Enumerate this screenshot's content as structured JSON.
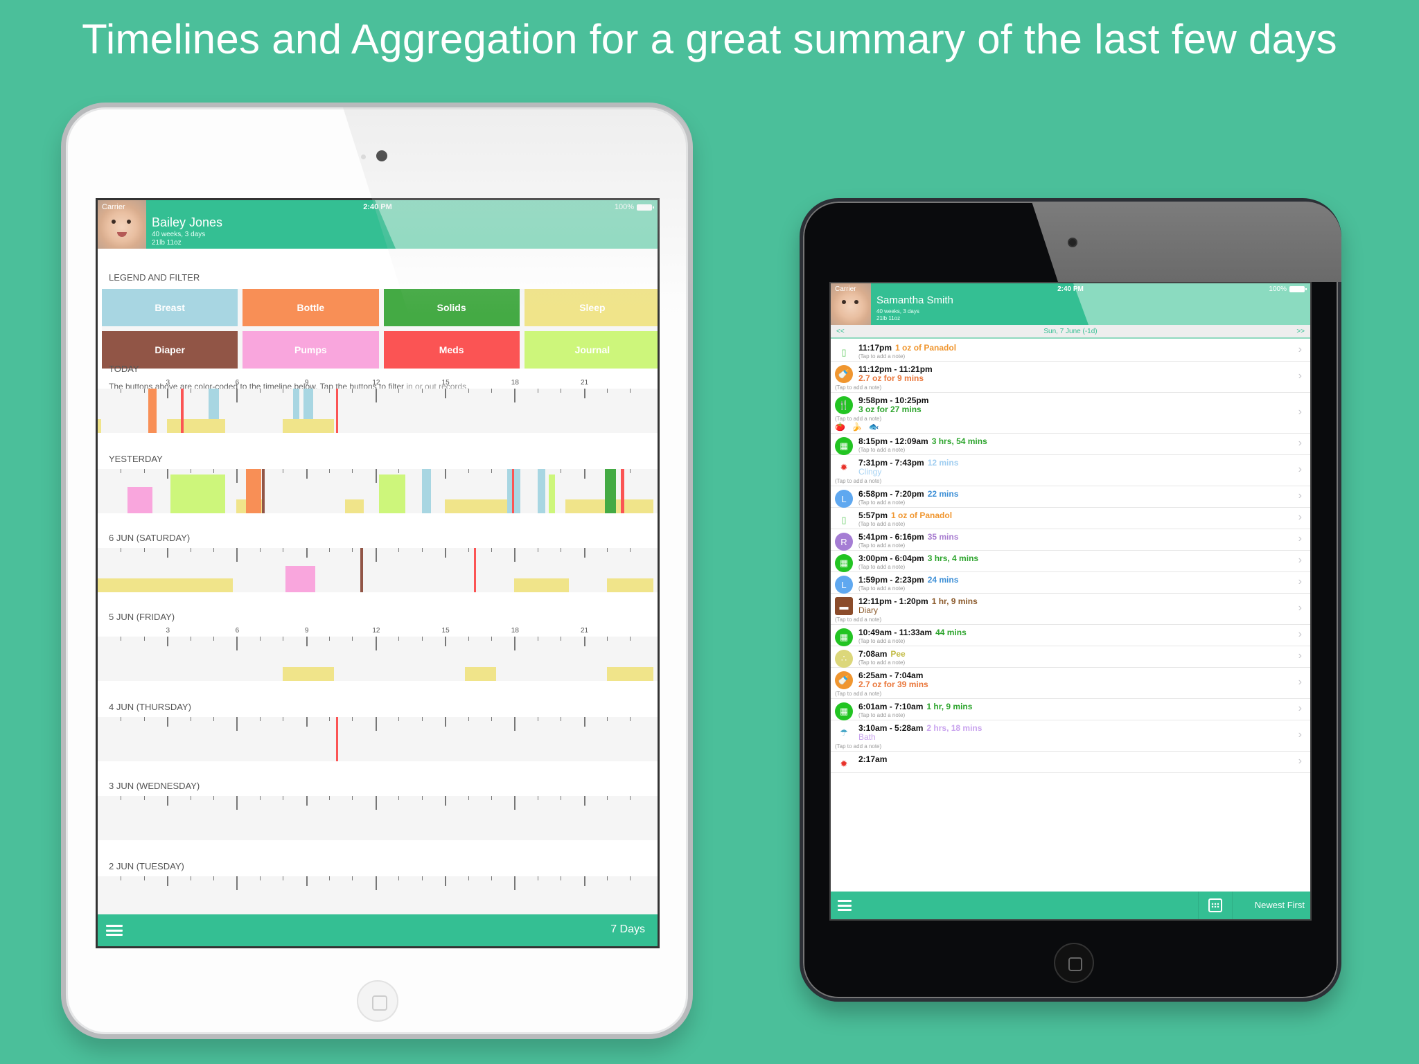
{
  "headline": "Timelines and Aggregation for a great summary of the last few days",
  "left_app": {
    "status": {
      "carrier": "Carrier",
      "time": "2:40 PM",
      "battery": "100%"
    },
    "profile": {
      "name": "Bailey Jones",
      "age": "40 weeks, 3 days",
      "weight": "21lb 11oz"
    },
    "legend_title": "LEGEND AND FILTER",
    "legend": [
      {
        "label": "Breast",
        "color": "#a8d6e2"
      },
      {
        "label": "Bottle",
        "color": "#f88f56"
      },
      {
        "label": "Solids",
        "color": "#44aa44"
      },
      {
        "label": "Sleep",
        "color": "#f0e48a"
      },
      {
        "label": "Diaper",
        "color": "#915546"
      },
      {
        "label": "Pumps",
        "color": "#f9a6dd"
      },
      {
        "label": "Meds",
        "color": "#fb5454"
      },
      {
        "label": "Journal",
        "color": "#cdf67b"
      }
    ],
    "legend_note": "The buttons above are color-coded to the timeline below. Tap the buttons to filter",
    "legend_note_dim": " in or out records.",
    "hour_labels": [
      "3",
      "6",
      "9",
      "12",
      "15",
      "18",
      "21"
    ],
    "days": [
      {
        "label": "TODAY",
        "show_hours": true,
        "events": [
          {
            "type": "Sleep",
            "start": 0.0,
            "end": 0.15,
            "row": "low"
          },
          {
            "type": "Bottle",
            "start": 2.2,
            "end": 2.55,
            "row": "full"
          },
          {
            "type": "Sleep",
            "start": 3.0,
            "end": 5.5,
            "row": "low"
          },
          {
            "type": "Meds",
            "start": 3.6,
            "end": 3.7,
            "row": "full"
          },
          {
            "type": "Breast",
            "start": 4.8,
            "end": 5.25,
            "row": "upper"
          },
          {
            "type": "Sleep",
            "start": 8.0,
            "end": 10.2,
            "row": "low"
          },
          {
            "type": "Breast",
            "start": 8.45,
            "end": 8.7,
            "row": "upper"
          },
          {
            "type": "Breast",
            "start": 8.9,
            "end": 9.3,
            "row": "upper"
          },
          {
            "type": "Meds",
            "start": 10.3,
            "end": 10.4,
            "row": "full"
          }
        ]
      },
      {
        "label": "YESTERDAY",
        "show_hours": false,
        "events": [
          {
            "type": "Pumps",
            "start": 1.3,
            "end": 2.35,
            "row": "mid"
          },
          {
            "type": "Journal",
            "start": 3.15,
            "end": 5.5,
            "row": "tall"
          },
          {
            "type": "Sleep",
            "start": 6.0,
            "end": 7.1,
            "row": "low"
          },
          {
            "type": "Bottle",
            "start": 6.4,
            "end": 7.05,
            "row": "full"
          },
          {
            "type": "Diaper",
            "start": 7.1,
            "end": 7.2,
            "row": "full"
          },
          {
            "type": "Sleep",
            "start": 10.7,
            "end": 11.5,
            "row": "low"
          },
          {
            "type": "Journal",
            "start": 12.15,
            "end": 13.3,
            "row": "tall"
          },
          {
            "type": "Breast",
            "start": 14.0,
            "end": 14.4,
            "row": "full"
          },
          {
            "type": "Sleep",
            "start": 15.0,
            "end": 18.1,
            "row": "low"
          },
          {
            "type": "Breast",
            "start": 17.7,
            "end": 18.25,
            "row": "full"
          },
          {
            "type": "Meds",
            "start": 17.9,
            "end": 18.0,
            "row": "full"
          },
          {
            "type": "Breast",
            "start": 19.0,
            "end": 19.35,
            "row": "full"
          },
          {
            "type": "Journal",
            "start": 19.5,
            "end": 19.75,
            "row": "tall"
          },
          {
            "type": "Sleep",
            "start": 20.2,
            "end": 24.0,
            "row": "low"
          },
          {
            "type": "Solids",
            "start": 21.9,
            "end": 22.4,
            "row": "full"
          },
          {
            "type": "Meds",
            "start": 22.6,
            "end": 22.75,
            "row": "full"
          }
        ]
      },
      {
        "label": "6 JUN (SATURDAY)",
        "show_hours": false,
        "events": [
          {
            "type": "Sleep",
            "start": 0.0,
            "end": 5.85,
            "row": "low"
          },
          {
            "type": "Pumps",
            "start": 8.1,
            "end": 9.4,
            "row": "mid"
          },
          {
            "type": "Diaper",
            "start": 11.35,
            "end": 11.45,
            "row": "full"
          },
          {
            "type": "Meds",
            "start": 16.25,
            "end": 16.35,
            "row": "full"
          },
          {
            "type": "Sleep",
            "start": 18.0,
            "end": 20.35,
            "row": "low"
          },
          {
            "type": "Sleep",
            "start": 22.0,
            "end": 24.0,
            "row": "low"
          }
        ]
      },
      {
        "label": "5 JUN (FRIDAY)",
        "show_hours": true,
        "events": [
          {
            "type": "Sleep",
            "start": 8.0,
            "end": 10.2,
            "row": "low"
          },
          {
            "type": "Sleep",
            "start": 15.85,
            "end": 17.2,
            "row": "low"
          },
          {
            "type": "Sleep",
            "start": 22.0,
            "end": 24.0,
            "row": "low"
          }
        ]
      },
      {
        "label": "4 JUN (THURSDAY)",
        "show_hours": false,
        "events": [
          {
            "type": "Meds",
            "start": 10.3,
            "end": 10.4,
            "row": "full"
          }
        ]
      },
      {
        "label": "3 JUN (WEDNESDAY)",
        "show_hours": false,
        "events": []
      },
      {
        "label": "2 JUN (TUESDAY)",
        "show_hours": false,
        "events": []
      }
    ],
    "bottom": {
      "menu_icon": "hamburger-icon",
      "range_label": "7 Days"
    }
  },
  "right_app": {
    "status": {
      "carrier": "Carrier",
      "time": "2:40 PM",
      "battery": "100%"
    },
    "profile": {
      "name": "Samantha Smith",
      "age": "40 weeks, 3 days",
      "weight": "21lb 11oz"
    },
    "date_nav": {
      "prev": "<<",
      "date": "Sun, 7 June (-1d)",
      "next": ">>"
    },
    "items": [
      {
        "icon": "medicine-bottle-icon",
        "time": "11:17pm",
        "value": "1 oz of Panadol",
        "value_color": "#f0962f",
        "second": "",
        "note": "(Tap to add a note)",
        "h": 31
      },
      {
        "icon": "bottle-icon",
        "time": "11:12pm - 11:21pm",
        "value": "",
        "second": "2.7 oz for 9 mins",
        "value_color": "#e9763a",
        "note": "(Tap to add a note)",
        "h": 45
      },
      {
        "icon": "solids-icon",
        "time": "9:58pm - 10:25pm",
        "value": "",
        "second": "3 oz for 27 mins",
        "value_color": "#2ca42c",
        "note": "(Tap to add a note)",
        "foods": "🍅 🍌 🐟",
        "h": 59
      },
      {
        "icon": "crib-icon",
        "time": "8:15pm - 12:09am",
        "value": "3 hrs, 54 mins",
        "value_color": "#2ca42c",
        "second": "",
        "note": "(Tap to add a note)",
        "h": 31
      },
      {
        "icon": "mood-flower-icon",
        "time": "7:31pm - 7:43pm",
        "value": "12 mins",
        "value_color": "#9fcdf0",
        "second": "Clingy",
        "second_color": "#a8d3f3",
        "note": "(Tap to add a note)",
        "h": 45
      },
      {
        "icon": "left-breast-icon",
        "time": "6:58pm - 7:20pm",
        "value": "22 mins",
        "value_color": "#3d8fd6",
        "second": "",
        "note": "(Tap to add a note)",
        "h": 31
      },
      {
        "icon": "medicine-bottle-icon",
        "time": "5:57pm",
        "value": "1 oz of Panadol",
        "value_color": "#f0962f",
        "second": "",
        "note": "(Tap to add a note)",
        "h": 31
      },
      {
        "icon": "right-breast-icon",
        "time": "5:41pm - 6:16pm",
        "value": "35 mins",
        "value_color": "#a87dd0",
        "second": "",
        "note": "(Tap to add a note)",
        "h": 31
      },
      {
        "icon": "crib-icon",
        "time": "3:00pm - 6:04pm",
        "value": "3 hrs, 4 mins",
        "value_color": "#2ca42c",
        "second": "",
        "note": "(Tap to add a note)",
        "h": 31
      },
      {
        "icon": "left-breast-icon",
        "time": "1:59pm - 2:23pm",
        "value": "24 mins",
        "value_color": "#3d8fd6",
        "second": "",
        "note": "(Tap to add a note)",
        "h": 31
      },
      {
        "icon": "diary-icon",
        "time": "12:11pm - 1:20pm",
        "value": "1 hr, 9 mins",
        "value_color": "#8b5a2b",
        "second": "Diary",
        "second_color": "#8b5a2b",
        "note": "(Tap to add a note)",
        "h": 45
      },
      {
        "icon": "crib-icon",
        "time": "10:49am - 11:33am",
        "value": "44 mins",
        "value_color": "#2ca42c",
        "second": "",
        "note": "(Tap to add a note)",
        "h": 31
      },
      {
        "icon": "pee-drops-icon",
        "time": "7:08am",
        "value": "Pee",
        "value_color": "#c2bb45",
        "second": "",
        "note": "(Tap to add a note)",
        "h": 31
      },
      {
        "icon": "bottle-icon",
        "time": "6:25am - 7:04am",
        "value": "",
        "second": "2.7 oz for 39 mins",
        "value_color": "#e9763a",
        "note": "(Tap to add a note)",
        "h": 45
      },
      {
        "icon": "crib-icon",
        "time": "6:01am - 7:10am",
        "value": "1 hr, 9 mins",
        "value_color": "#2ca42c",
        "second": "",
        "note": "(Tap to add a note)",
        "h": 31
      },
      {
        "icon": "shower-icon",
        "time": "3:10am - 5:28am",
        "value": "2 hrs, 18 mins",
        "value_color": "#c9a3ee",
        "second": "Bath",
        "second_color": "#c9a3ee",
        "note": "(Tap to add a note)",
        "h": 45
      },
      {
        "icon": "mood-flower-icon",
        "time": "2:17am",
        "value": "",
        "value_color": "#9fcdf0",
        "second": "",
        "note": "",
        "h": 31
      }
    ],
    "bottom": {
      "menu_icon": "hamburger-icon",
      "calendar_icon": "calendar-icon",
      "sort_label": "Newest First"
    }
  }
}
